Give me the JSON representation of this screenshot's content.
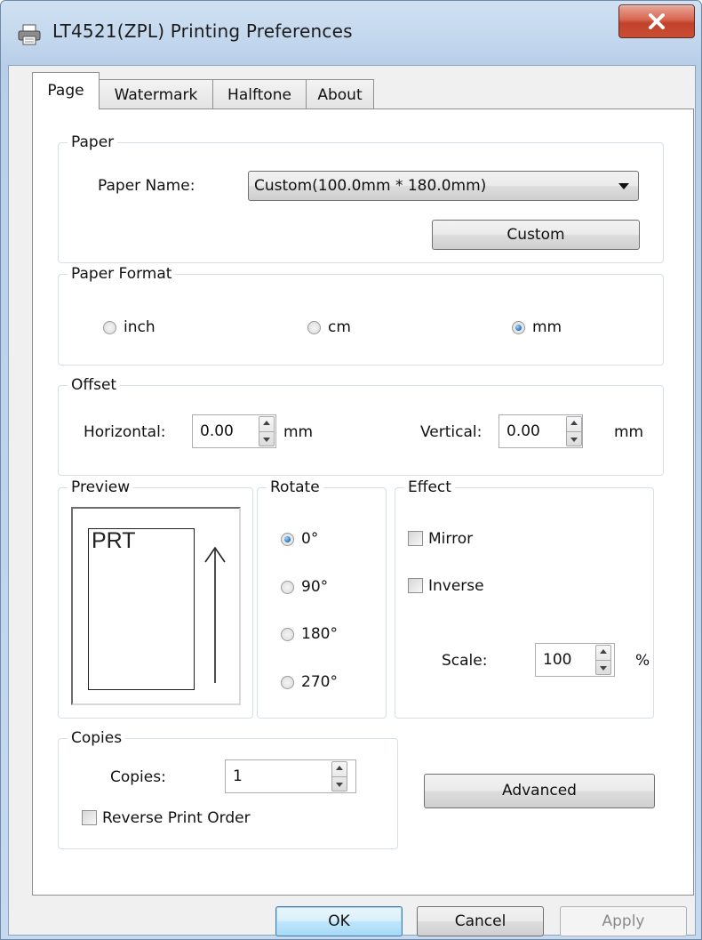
{
  "window": {
    "title": "LT4521(ZPL) Printing Preferences"
  },
  "tabs": [
    {
      "label": "Page",
      "active": true
    },
    {
      "label": "Watermark",
      "active": false
    },
    {
      "label": "Halftone",
      "active": false
    },
    {
      "label": "About",
      "active": false
    }
  ],
  "paper": {
    "group_label": "Paper",
    "name_label": "Paper Name:",
    "name_value": "Custom(100.0mm * 180.0mm)",
    "custom_button": "Custom"
  },
  "paper_format": {
    "group_label": "Paper Format",
    "options": [
      "inch",
      "cm",
      "mm"
    ],
    "selected": "mm"
  },
  "offset": {
    "group_label": "Offset",
    "horizontal_label": "Horizontal:",
    "horizontal_value": "0.00",
    "horizontal_unit": "mm",
    "vertical_label": "Vertical:",
    "vertical_value": "0.00",
    "vertical_unit": "mm"
  },
  "preview": {
    "group_label": "Preview",
    "text": "PRT"
  },
  "rotate": {
    "group_label": "Rotate",
    "options": [
      "0°",
      "90°",
      "180°",
      "270°"
    ],
    "selected": "0°"
  },
  "effect": {
    "group_label": "Effect",
    "mirror_label": "Mirror",
    "mirror_checked": false,
    "inverse_label": "Inverse",
    "inverse_checked": false,
    "scale_label": "Scale:",
    "scale_value": "100",
    "scale_unit": "%"
  },
  "copies": {
    "group_label": "Copies",
    "copies_label": "Copies:",
    "copies_value": "1",
    "reverse_label": "Reverse Print Order",
    "reverse_checked": false
  },
  "advanced_button": "Advanced",
  "footer": {
    "ok": "OK",
    "cancel": "Cancel",
    "apply": "Apply"
  },
  "colors": {
    "title_bar": "#c4d8ee",
    "close_button": "#c94e34",
    "dialog_bg": "#f0f0f0",
    "radio_selected": "#1d6fb8"
  }
}
